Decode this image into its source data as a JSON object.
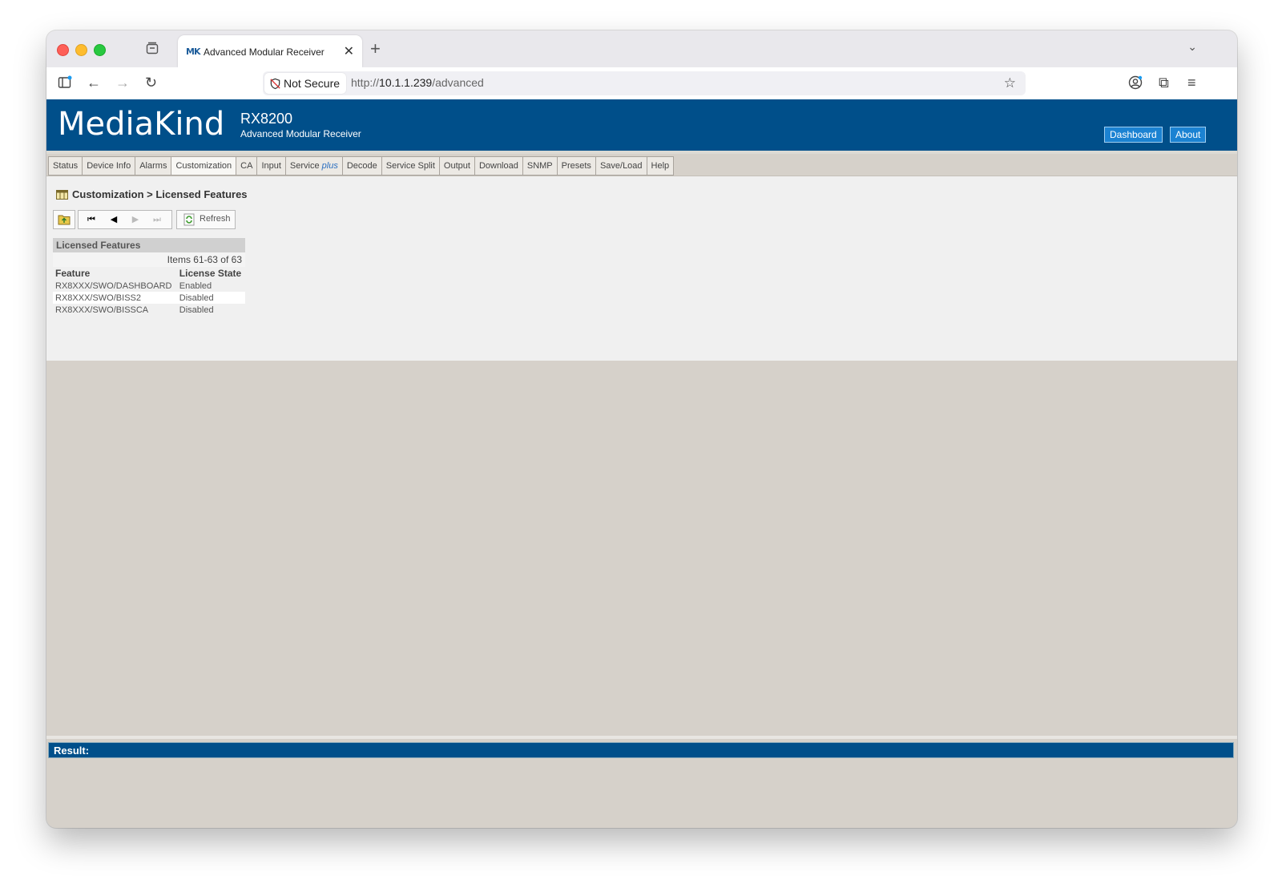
{
  "browser": {
    "tab_title": "Advanced Modular Receiver",
    "tab_favicon": "MK",
    "security_label": "Not Secure",
    "url_prefix": "http://",
    "url_host": "10.1.1.239",
    "url_path": "/advanced"
  },
  "header": {
    "logo": "MediaKind",
    "product": "RX8200",
    "product_subtitle": "Advanced Modular Receiver",
    "dashboard_label": "Dashboard",
    "about_label": "About",
    "bar_color": "#004f8a"
  },
  "menu": {
    "items": [
      "Status",
      "Device Info",
      "Alarms",
      "Customization",
      "CA",
      "Input",
      "Service",
      "Decode",
      "Service Split",
      "Output",
      "Download",
      "SNMP",
      "Presets",
      "Save/Load",
      "Help"
    ],
    "service_suffix": "plus",
    "active": "Customization"
  },
  "page": {
    "breadcrumb": "Customization > Licensed Features",
    "refresh_label": "Refresh",
    "panel_title": "Licensed Features",
    "items_count": "Items 61-63 of 63",
    "columns": [
      "Feature",
      "License State"
    ],
    "rows": [
      [
        "RX8XXX/SWO/DASHBOARD",
        "Enabled"
      ],
      [
        "RX8XXX/SWO/BISS2",
        "Disabled"
      ],
      [
        "RX8XXX/SWO/BISSCA",
        "Disabled"
      ]
    ],
    "result_label": "Result:"
  }
}
